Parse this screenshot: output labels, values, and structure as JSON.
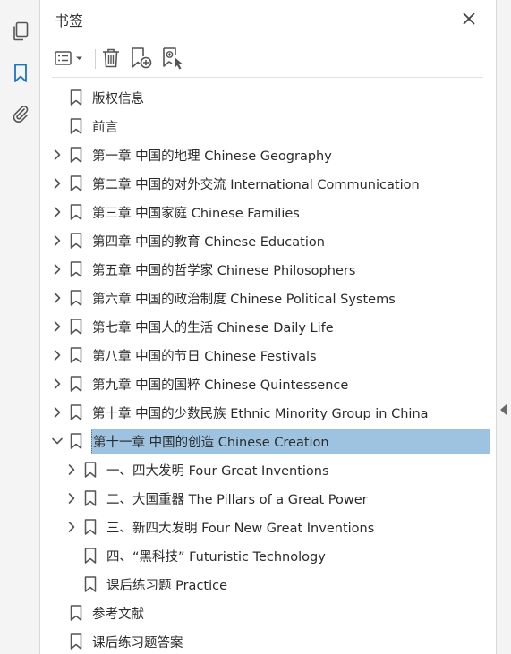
{
  "panel": {
    "title": "书签"
  },
  "rail": {
    "items": [
      {
        "name": "pages-icon"
      },
      {
        "name": "bookmarks-icon",
        "active": true
      },
      {
        "name": "attachments-icon"
      }
    ]
  },
  "toolbar": {
    "tools": [
      "options-menu-icon",
      "delete-icon",
      "new-bookmark-icon",
      "bookmark-from-selection-icon"
    ]
  },
  "bookmarks": [
    {
      "label": "版权信息",
      "level": 0,
      "expander": "none"
    },
    {
      "label": "前言",
      "level": 0,
      "expander": "none"
    },
    {
      "label": "第一章 中国的地理 Chinese Geography",
      "level": 0,
      "expander": "collapsed"
    },
    {
      "label": "第二章 中国的对外交流 International Communication",
      "level": 0,
      "expander": "collapsed"
    },
    {
      "label": "第三章 中国家庭 Chinese Families",
      "level": 0,
      "expander": "collapsed"
    },
    {
      "label": "第四章 中国的教育 Chinese Education",
      "level": 0,
      "expander": "collapsed"
    },
    {
      "label": "第五章 中国的哲学家 Chinese Philosophers",
      "level": 0,
      "expander": "collapsed"
    },
    {
      "label": "第六章 中国的政治制度 Chinese Political Systems",
      "level": 0,
      "expander": "collapsed"
    },
    {
      "label": "第七章 中国人的生活 Chinese Daily Life",
      "level": 0,
      "expander": "collapsed"
    },
    {
      "label": "第八章 中国的节日 Chinese Festivals",
      "level": 0,
      "expander": "collapsed"
    },
    {
      "label": "第九章 中国的国粹 Chinese Quintessence",
      "level": 0,
      "expander": "collapsed"
    },
    {
      "label": "第十章 中国的少数民族 Ethnic Minority Group in China",
      "level": 0,
      "expander": "collapsed"
    },
    {
      "label": "第十一章 中国的创造 Chinese Creation",
      "level": 0,
      "expander": "expanded",
      "selected": true
    },
    {
      "label": "一、四大发明 Four Great Inventions",
      "level": 1,
      "expander": "collapsed"
    },
    {
      "label": "二、大国重器 The Pillars of a Great Power",
      "level": 1,
      "expander": "collapsed"
    },
    {
      "label": "三、新四大发明 Four New Great Inventions",
      "level": 1,
      "expander": "collapsed"
    },
    {
      "label": "四、“黑科技” Futuristic Technology",
      "level": 1,
      "expander": "none"
    },
    {
      "label": "课后练习题 Practice",
      "level": 1,
      "expander": "none"
    },
    {
      "label": "参考文献",
      "level": 0,
      "expander": "none"
    },
    {
      "label": "课后练习题答案",
      "level": 0,
      "expander": "none"
    }
  ],
  "colors": {
    "accent": "#1a73c7",
    "selection": "#9ec3e0",
    "icon": "#555555"
  }
}
